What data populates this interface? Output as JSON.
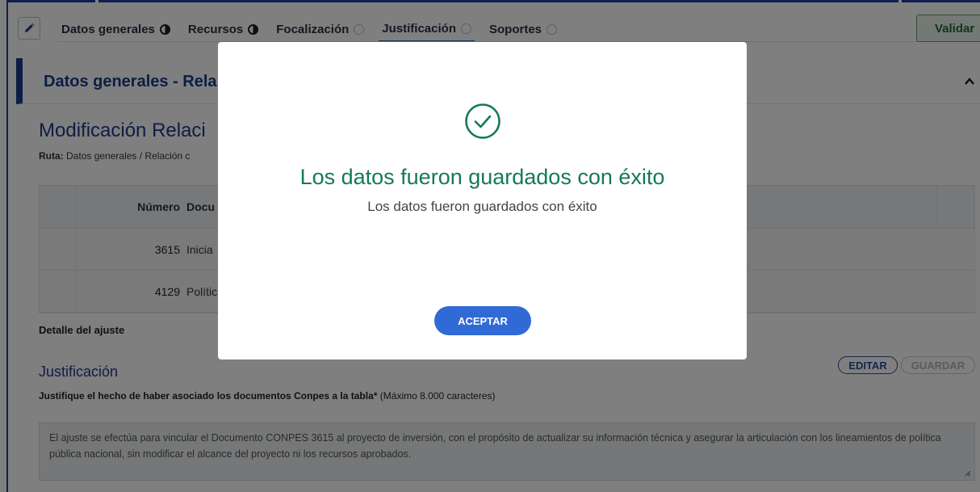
{
  "tabs": [
    {
      "label": "Datos generales",
      "status": "half"
    },
    {
      "label": "Recursos",
      "status": "half"
    },
    {
      "label": "Focalización",
      "status": "empty"
    },
    {
      "label": "Justificación",
      "status": "empty"
    },
    {
      "label": "Soportes",
      "status": "empty"
    }
  ],
  "toolbar": {
    "validar_label": "Validar"
  },
  "section": {
    "title": "Datos generales - Rela"
  },
  "page": {
    "title": "Modificación Relaci",
    "ruta_label": "Ruta:",
    "ruta_value": "Datos generales / Relación c"
  },
  "table": {
    "headers": {
      "numero": "Número",
      "documento": "Docu"
    },
    "rows": [
      {
        "numero": "3615",
        "documento": "Inicia"
      },
      {
        "numero": "4129",
        "documento": "Polític"
      }
    ]
  },
  "detalle": {
    "label": "Detalle del ajuste"
  },
  "justificacion": {
    "title": "Justificación",
    "edit_label": "EDITAR",
    "save_label": "GUARDAR",
    "question": "Justifique el hecho de haber asociado los documentos Conpes a la tabla*",
    "question_hint": " (Máximo 8.000 caracteres)",
    "text": "El ajuste se efectúa para vincular el Documento CONPES 3615 al proyecto de inversión, con el propósito de actualizar su información técnica y asegurar la articulación con los lineamientos de política pública nacional, sin modificar el alcance del proyecto ni los recursos aprobados."
  },
  "modal": {
    "icon": "check-circle-icon",
    "title": "Los datos fueron guardados con éxito",
    "subtitle": "Los datos fueron guardados con éxito",
    "button_label": "ACEPTAR"
  },
  "colors": {
    "primary": "#173c8a",
    "success": "#157a52",
    "button": "#2f6ad6",
    "validar": "#256b37"
  }
}
